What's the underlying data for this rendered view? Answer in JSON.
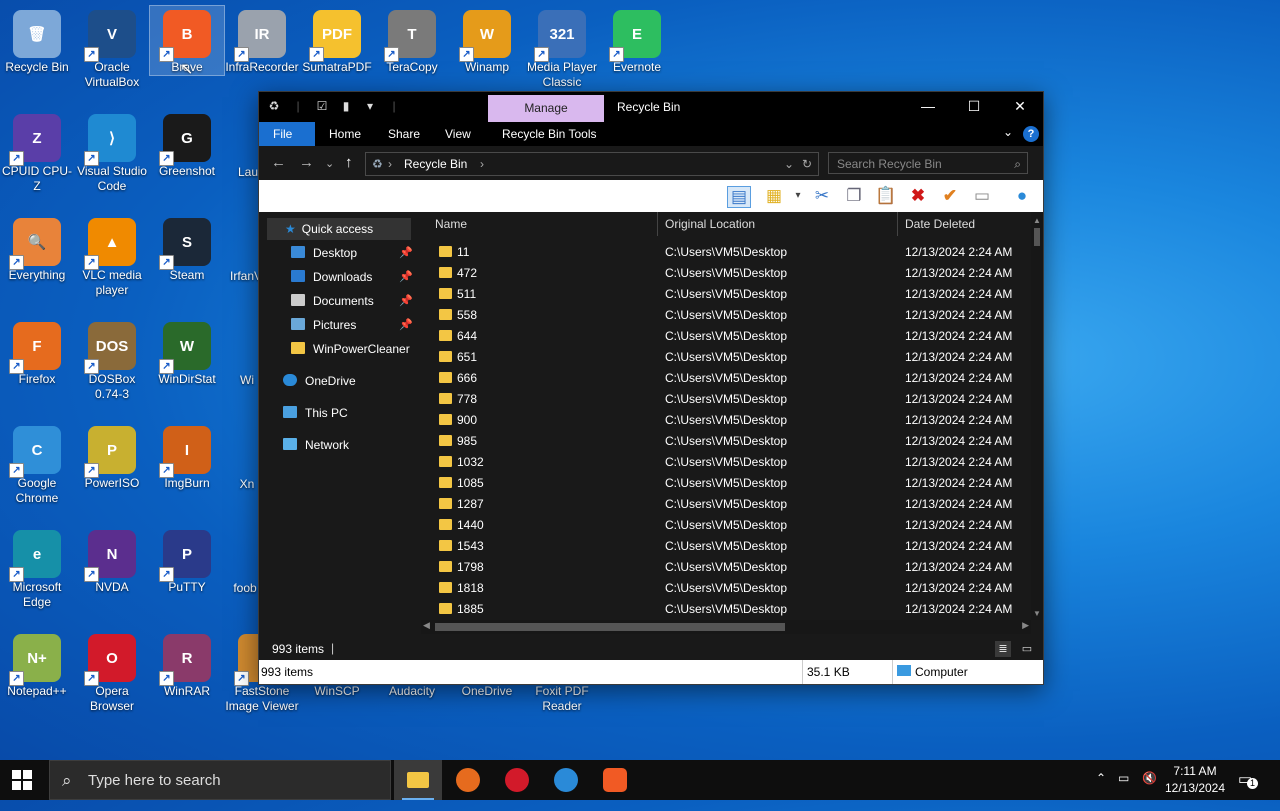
{
  "desktop": {
    "icons": [
      {
        "label": "Recycle Bin",
        "color": "#7da8d8",
        "glyph": "🗑"
      },
      {
        "label": "Oracle VirtualBox",
        "color": "#1d4e8a",
        "glyph": "V"
      },
      {
        "label": "Brave",
        "color": "#f15a24",
        "glyph": "B"
      },
      {
        "label": "InfraRecorder",
        "color": "#9aa2ad",
        "glyph": "IR"
      },
      {
        "label": "SumatraPDF",
        "color": "#f5c12e",
        "glyph": "PDF"
      },
      {
        "label": "TeraCopy",
        "color": "#7a7a7a",
        "glyph": "T"
      },
      {
        "label": "Winamp",
        "color": "#e59b1a",
        "glyph": "W"
      },
      {
        "label": "Media Player Classic",
        "color": "#3a6fb8",
        "glyph": "321"
      },
      {
        "label": "Evernote",
        "color": "#2dbe60",
        "glyph": "E"
      },
      {
        "label": "CPUID CPU-Z",
        "color": "#5a3ea8",
        "glyph": "Z"
      },
      {
        "label": "Visual Studio Code",
        "color": "#1f8ad2",
        "glyph": "⟩"
      },
      {
        "label": "Greenshot",
        "color": "#1a1a1a",
        "glyph": "G"
      },
      {
        "label": "Everything",
        "color": "#e8833a",
        "glyph": "🔍"
      },
      {
        "label": "VLC media player",
        "color": "#f08a00",
        "glyph": "▲"
      },
      {
        "label": "Steam",
        "color": "#1b2838",
        "glyph": "S"
      },
      {
        "label": "Firefox",
        "color": "#e66b1e",
        "glyph": "F"
      },
      {
        "label": "DOSBox 0.74-3",
        "color": "#8a6a3a",
        "glyph": "DOS"
      },
      {
        "label": "WinDirStat",
        "color": "#2a6a2a",
        "glyph": "W"
      },
      {
        "label": "Google Chrome",
        "color": "#2f8fd8",
        "glyph": "C"
      },
      {
        "label": "PowerISO",
        "color": "#c8b030",
        "glyph": "P"
      },
      {
        "label": "ImgBurn",
        "color": "#d06018",
        "glyph": "I"
      },
      {
        "label": "Microsoft Edge",
        "color": "#1690a8",
        "glyph": "e"
      },
      {
        "label": "NVDA",
        "color": "#5b2e8e",
        "glyph": "N"
      },
      {
        "label": "PuTTY",
        "color": "#2a3a8a",
        "glyph": "P"
      },
      {
        "label": "Notepad++",
        "color": "#8ab04a",
        "glyph": "N+"
      },
      {
        "label": "Opera Browser",
        "color": "#d21a2a",
        "glyph": "O"
      },
      {
        "label": "WinRAR",
        "color": "#8a3a6a",
        "glyph": "R"
      },
      {
        "label": "FastStone Image Viewer",
        "color": "#d08a30",
        "glyph": "F"
      },
      {
        "label": "WinSCP",
        "color": "",
        "glyph": ""
      },
      {
        "label": "Audacity",
        "color": "",
        "glyph": ""
      },
      {
        "label": "OneDrive",
        "color": "",
        "glyph": ""
      },
      {
        "label": "Foxit PDF Reader",
        "color": "",
        "glyph": ""
      }
    ],
    "partial_labels": [
      "Lau",
      "IrfanV",
      "Wi",
      "Xn",
      "foob"
    ]
  },
  "window": {
    "title": "Recycle Bin",
    "manage_label": "Manage",
    "ribbon_tabs": [
      "File",
      "Home",
      "Share",
      "View",
      "Recycle Bin Tools"
    ],
    "address": "Recycle Bin",
    "search_placeholder": "Search Recycle Bin",
    "nav": {
      "quick_access": "Quick access",
      "pinned": [
        "Desktop",
        "Downloads",
        "Documents",
        "Pictures"
      ],
      "extra": "WinPowerCleaner",
      "onedrive": "OneDrive",
      "this_pc": "This PC",
      "network": "Network"
    },
    "columns": [
      "Name",
      "Original Location",
      "Date Deleted"
    ],
    "rows": [
      {
        "name": "11",
        "location": "C:\\Users\\VM5\\Desktop",
        "date": "12/13/2024 2:24 AM"
      },
      {
        "name": "472",
        "location": "C:\\Users\\VM5\\Desktop",
        "date": "12/13/2024 2:24 AM"
      },
      {
        "name": "511",
        "location": "C:\\Users\\VM5\\Desktop",
        "date": "12/13/2024 2:24 AM"
      },
      {
        "name": "558",
        "location": "C:\\Users\\VM5\\Desktop",
        "date": "12/13/2024 2:24 AM"
      },
      {
        "name": "644",
        "location": "C:\\Users\\VM5\\Desktop",
        "date": "12/13/2024 2:24 AM"
      },
      {
        "name": "651",
        "location": "C:\\Users\\VM5\\Desktop",
        "date": "12/13/2024 2:24 AM"
      },
      {
        "name": "666",
        "location": "C:\\Users\\VM5\\Desktop",
        "date": "12/13/2024 2:24 AM"
      },
      {
        "name": "778",
        "location": "C:\\Users\\VM5\\Desktop",
        "date": "12/13/2024 2:24 AM"
      },
      {
        "name": "900",
        "location": "C:\\Users\\VM5\\Desktop",
        "date": "12/13/2024 2:24 AM"
      },
      {
        "name": "985",
        "location": "C:\\Users\\VM5\\Desktop",
        "date": "12/13/2024 2:24 AM"
      },
      {
        "name": "1032",
        "location": "C:\\Users\\VM5\\Desktop",
        "date": "12/13/2024 2:24 AM"
      },
      {
        "name": "1085",
        "location": "C:\\Users\\VM5\\Desktop",
        "date": "12/13/2024 2:24 AM"
      },
      {
        "name": "1287",
        "location": "C:\\Users\\VM5\\Desktop",
        "date": "12/13/2024 2:24 AM"
      },
      {
        "name": "1440",
        "location": "C:\\Users\\VM5\\Desktop",
        "date": "12/13/2024 2:24 AM"
      },
      {
        "name": "1543",
        "location": "C:\\Users\\VM5\\Desktop",
        "date": "12/13/2024 2:24 AM"
      },
      {
        "name": "1798",
        "location": "C:\\Users\\VM5\\Desktop",
        "date": "12/13/2024 2:24 AM"
      },
      {
        "name": "1818",
        "location": "C:\\Users\\VM5\\Desktop",
        "date": "12/13/2024 2:24 AM"
      },
      {
        "name": "1885",
        "location": "C:\\Users\\VM5\\Desktop",
        "date": "12/13/2024 2:24 AM"
      }
    ],
    "status_items": "993 items",
    "status2_items": "993 items",
    "status2_size": "35.1 KB",
    "status2_location": "Computer"
  },
  "taskbar": {
    "search_placeholder": "Type here to search",
    "time": "7:11 AM",
    "date": "12/13/2024",
    "notification_count": "1"
  },
  "colors": {
    "accent": "#1a6fd0",
    "manage_tab": "#d9b8ee",
    "folder": "#f3c644"
  }
}
